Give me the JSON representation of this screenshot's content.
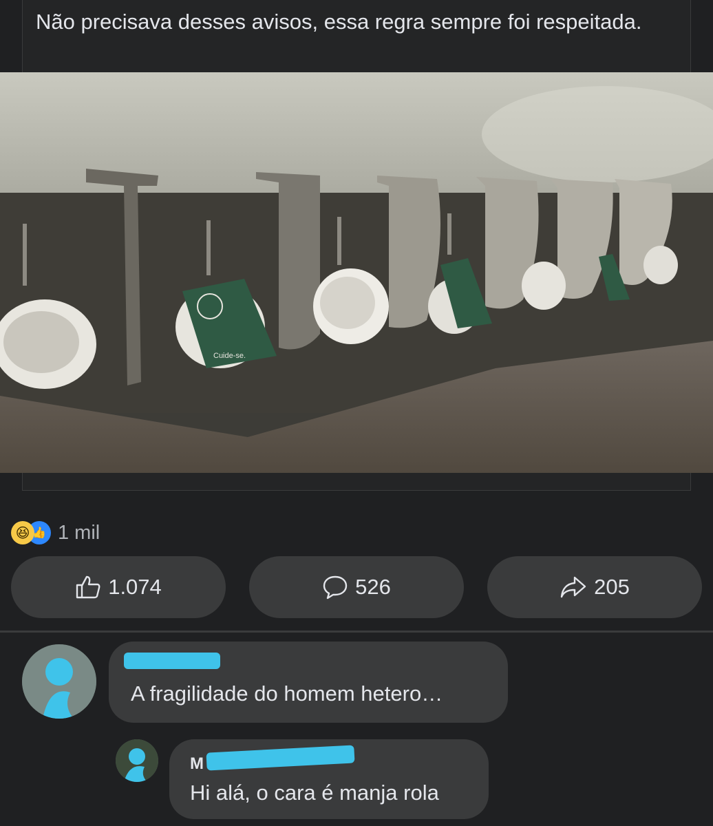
{
  "post": {
    "text": "Não precisava desses avisos, essa regra sempre foi respeitada."
  },
  "photo": {
    "sign_text": "Cuide-se."
  },
  "reactions": {
    "icons": [
      "haha-icon",
      "like-icon"
    ],
    "count": "1 mil"
  },
  "actions": {
    "like_count": "1.074",
    "comment_count": "526",
    "share_count": "205"
  },
  "comments": [
    {
      "name": "",
      "text": "A fragilidade do homem hetero…"
    },
    {
      "name": "M",
      "text": "Hi alá, o cara é manja rola"
    }
  ],
  "colors": {
    "background": "#1f2022",
    "card": "#242526",
    "button": "#3a3b3c",
    "text": "#e4e6eb",
    "muted": "#b0b3b8",
    "redaction": "#3fc3ea"
  }
}
